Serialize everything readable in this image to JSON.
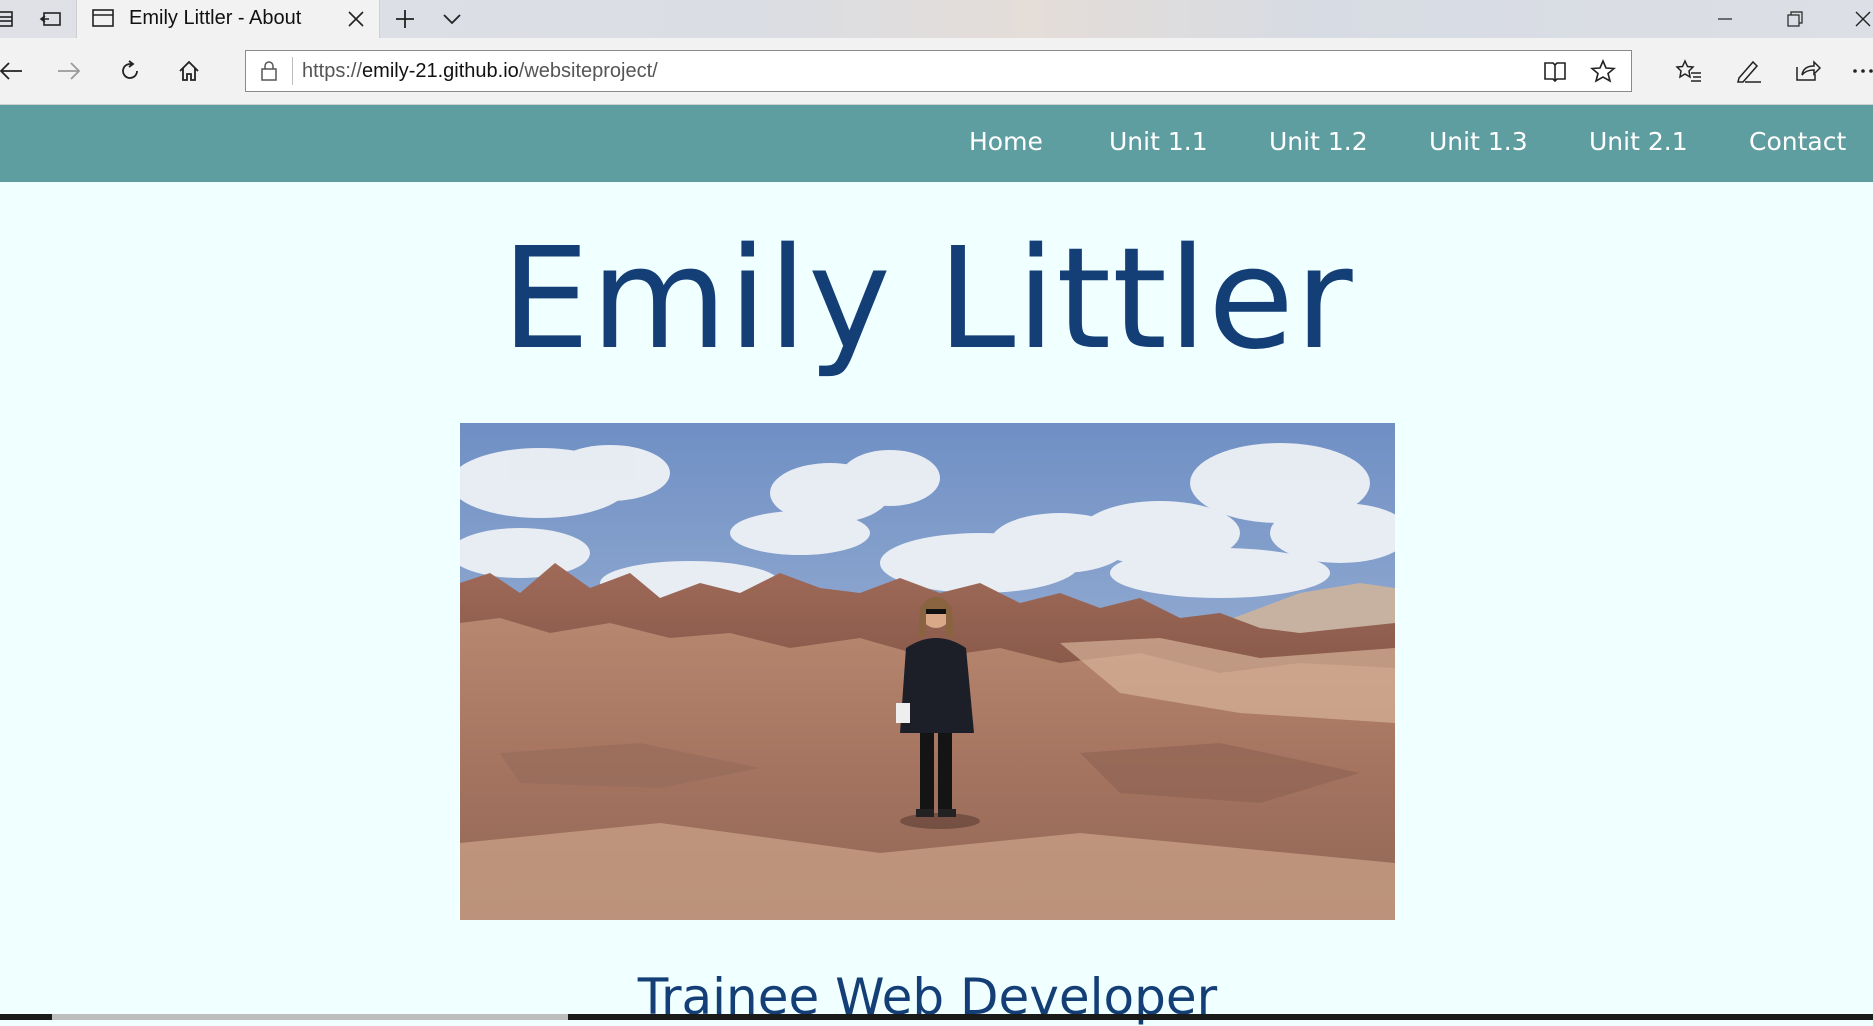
{
  "browser": {
    "tab_title": "Emily Littler - About",
    "url_prefix": "https://",
    "url_host": "emily-21.github.io",
    "url_path": "/websiteproject/"
  },
  "nav": {
    "items": [
      "Home",
      "Unit 1.1",
      "Unit 1.2",
      "Unit 1.3",
      "Unit 2.1",
      "Contact"
    ],
    "background": "#5f9ea0"
  },
  "page": {
    "title": "Emily Littler",
    "subtitle": "Trainee Web Developer",
    "title_color": "#143f76",
    "background": "#f0ffff"
  }
}
